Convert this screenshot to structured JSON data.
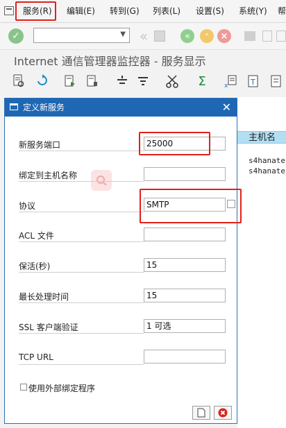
{
  "menubar": {
    "items": [
      {
        "label": "服务(R)"
      },
      {
        "label": "编辑(E)"
      },
      {
        "label": "转到(G)"
      },
      {
        "label": "列表(L)"
      },
      {
        "label": "设置(S)"
      },
      {
        "label": "系统(Y)"
      },
      {
        "label": "帮"
      }
    ]
  },
  "window": {
    "title": "Internet 通信管理器监控器 - 服务显示"
  },
  "table": {
    "column_header": "主机名",
    "rows": [
      "s4hanate",
      "s4hanate"
    ]
  },
  "dialog": {
    "title": "定义新服务",
    "fields": [
      {
        "label": "新服务端口",
        "value": "25000"
      },
      {
        "label": "绑定到主机名称",
        "value": ""
      },
      {
        "label": "协议",
        "value": "SMTP"
      },
      {
        "label": "ACL 文件",
        "value": ""
      },
      {
        "label": "保活(秒)",
        "value": "15"
      },
      {
        "label": "最长处理时间",
        "value": "15"
      },
      {
        "label": "SSL 客户端验证",
        "value": "1 可选"
      },
      {
        "label": "TCP URL",
        "value": ""
      }
    ],
    "checkbox_label": "使用外部绑定程序"
  },
  "colors": {
    "dialog_titlebar": "#1e67b5",
    "highlight_box": "#e0201a",
    "confirm_green": "#3aa53a",
    "cancel_red": "#d9231d",
    "column_header": "#b3dff3"
  }
}
